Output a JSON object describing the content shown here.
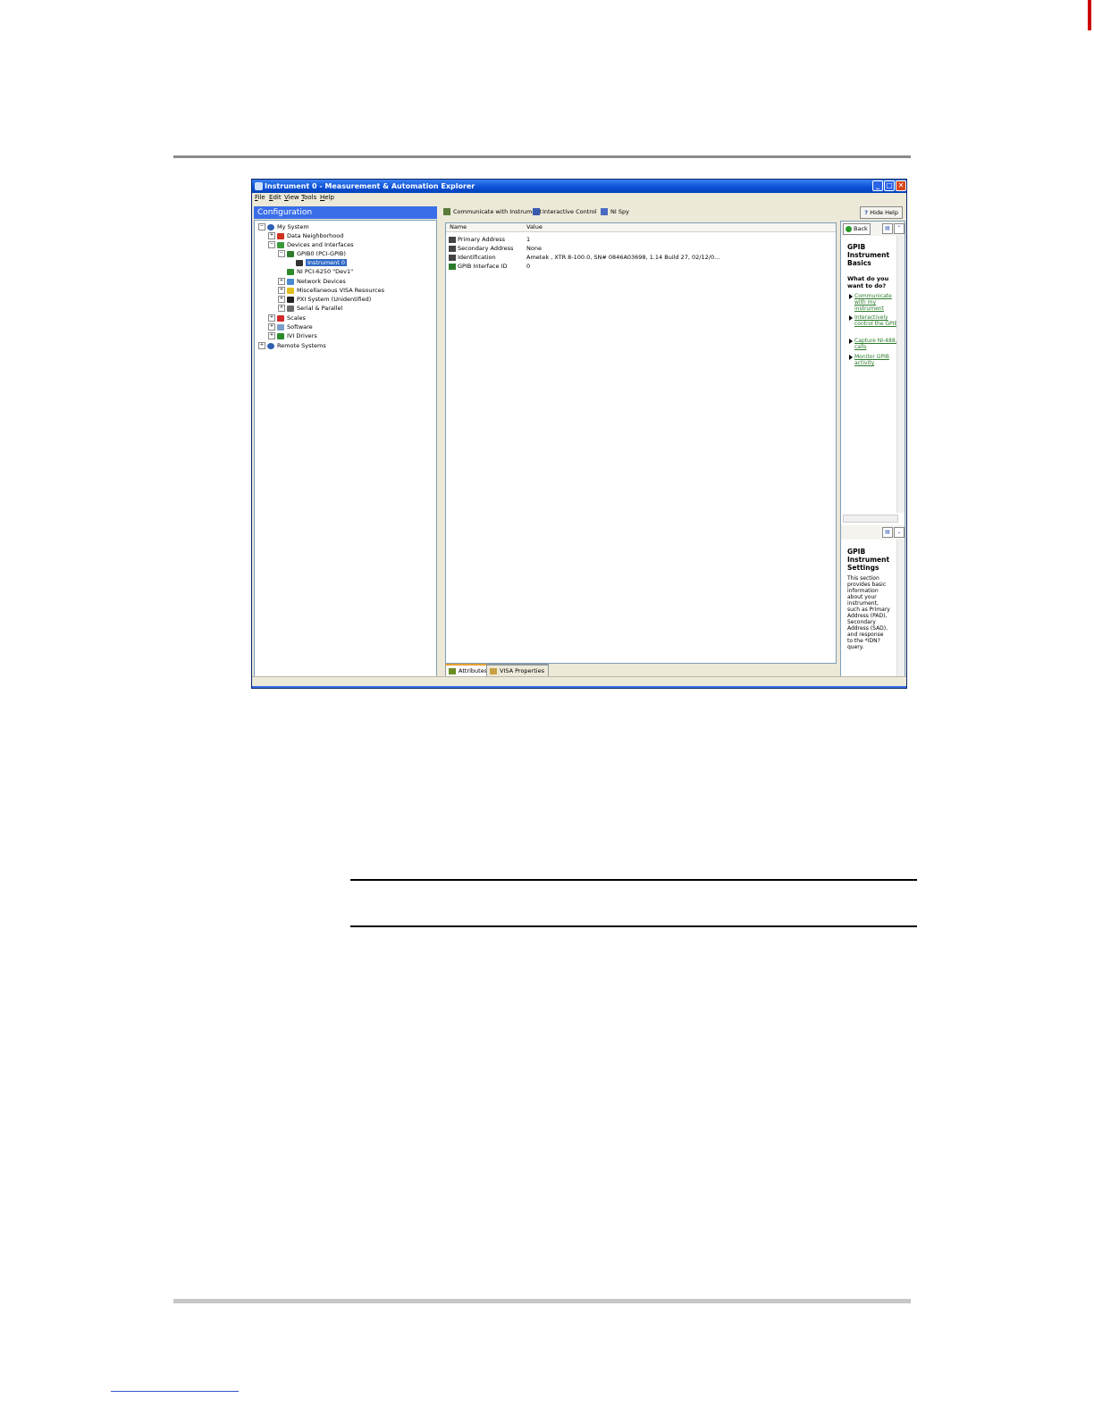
{
  "window": {
    "title": "Instrument 0 - Measurement & Automation Explorer"
  },
  "menu": [
    "File",
    "Edit",
    "View",
    "Tools",
    "Help"
  ],
  "config_header": "Configuration",
  "tree": [
    {
      "label": "My System",
      "expander": "−",
      "icon": "computer-icon"
    },
    {
      "label": "Data Neighborhood",
      "expander": "+",
      "icon": "data-neighborhood-icon"
    },
    {
      "label": "Devices and Interfaces",
      "expander": "−",
      "icon": "devices-icon"
    },
    {
      "label": "GPIB0 (PCI-GPIB)",
      "expander": "−",
      "icon": "gpib-board-icon"
    },
    {
      "label": "Instrument 0",
      "expander": "",
      "icon": "instrument-icon"
    },
    {
      "label": "NI PCI-6250 \"Dev1\"",
      "expander": "",
      "icon": "daq-card-icon"
    },
    {
      "label": "Network Devices",
      "expander": "+",
      "icon": "network-icon"
    },
    {
      "label": "Miscellaneous VISA Resources",
      "expander": "+",
      "icon": "visa-icon"
    },
    {
      "label": "PXI System (Unidentified)",
      "expander": "+",
      "icon": "pxi-icon"
    },
    {
      "label": "Serial & Parallel",
      "expander": "+",
      "icon": "serial-icon"
    },
    {
      "label": "Scales",
      "expander": "+",
      "icon": "scales-icon"
    },
    {
      "label": "Software",
      "expander": "+",
      "icon": "software-icon"
    },
    {
      "label": "IVI Drivers",
      "expander": "+",
      "icon": "ivi-icon"
    },
    {
      "label": "Remote Systems",
      "expander": "+",
      "icon": "remote-icon"
    }
  ],
  "toolbar": {
    "communicate": "Communicate with Instrument",
    "interactive": "Interactive Control",
    "nispy": "NI Spy",
    "hide_help": "Hide Help"
  },
  "table": {
    "col_name": "Name",
    "col_value": "Value",
    "rows": [
      {
        "name": "Primary Address",
        "value": "1"
      },
      {
        "name": "Secondary Address",
        "value": "None"
      },
      {
        "name": "Identification",
        "value": "Ametek , XTR 8-100.0, SN# 0846A03698, 1.14 Build 27, 02/12/0..."
      },
      {
        "name": "GPIB Interface ID",
        "value": "0"
      }
    ]
  },
  "tabs": {
    "attributes": "Attributes",
    "visa": "VISA Properties"
  },
  "help": {
    "back": "Back",
    "top_title": "GPIB Instrument Basics",
    "question": "What do you want to do?",
    "links": [
      "Communicate with my instrument",
      "Interactively control the GPIB",
      "Capture NI-488.2 calls",
      "Monitor GPIB activity"
    ],
    "bottom_title": "GPIB Instrument Settings",
    "bottom_body": "This section provides basic information about your instrument, such as Primary Address (PAD), Secondary Address (SAD), and response to the *IDN? query."
  },
  "colors": {
    "title_blue": "#0a4fd6",
    "config_blue": "#3a6ee8",
    "link_green": "#2a7a2a",
    "selection": "#316ac5"
  }
}
